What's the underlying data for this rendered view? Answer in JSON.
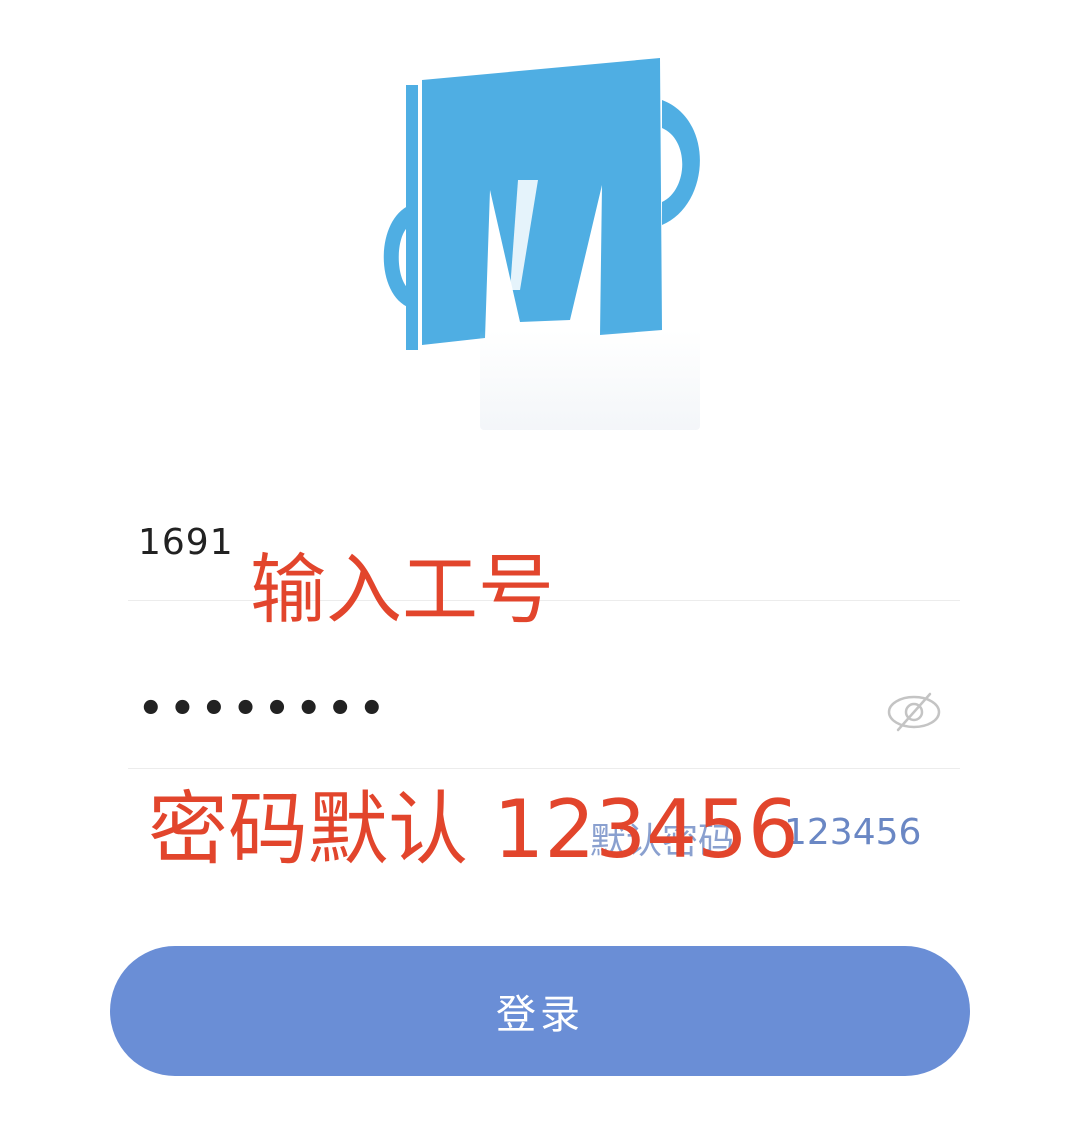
{
  "login_form": {
    "username": {
      "value": "1691"
    },
    "password": {
      "masked_value": "••••••••",
      "toggle_icon": "eye-off-icon"
    },
    "hint": {
      "label": "默认密码",
      "value": "123456"
    },
    "submit_label": "登录"
  },
  "annotations": {
    "username_note": "输入工号",
    "password_note": "密码默认 123456"
  },
  "colors": {
    "logo": "#4faee3",
    "button": "#6a8ed6",
    "annotation": "#e2452c",
    "hint": "#6a87c4"
  }
}
